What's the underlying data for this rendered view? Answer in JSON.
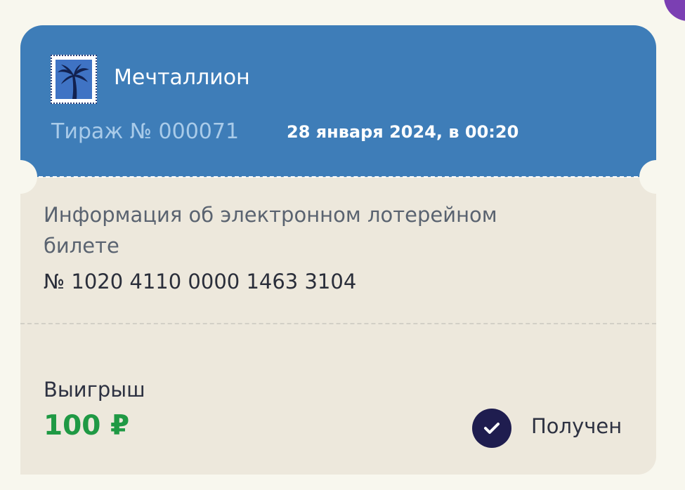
{
  "ticket": {
    "lottery_name": "Мечталлион",
    "logo_icon": "palm-tree-stamp-icon",
    "draw_number": "Тираж № 000071",
    "draw_date": "28 января 2024, в 00:20",
    "info_title": "Информация об электронном лотерейном билете",
    "ticket_number": "№ 1020 4110 0000 1463 3104",
    "win_label": "Выигрыш",
    "win_amount": "100 ₽",
    "status_icon": "check-circle-icon",
    "status": "Получен"
  },
  "colors": {
    "header_bg": "#3e7db8",
    "body_bg": "#ede8dc",
    "win_amount": "#1f9944",
    "status_icon_bg": "#1f1d4f",
    "draw_number": "#a9cbe9"
  }
}
